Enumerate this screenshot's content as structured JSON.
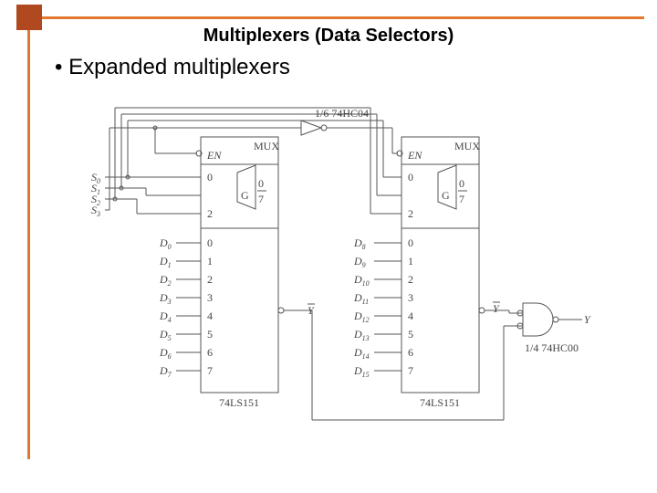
{
  "header": {
    "title": "Multiplexers (Data Selectors)"
  },
  "bullet": "•  Expanded multiplexers",
  "labels": {
    "inverter_chip": "1/6 74HC04",
    "nand_chip": "1/4 74HC00",
    "mux_caption_left": "74LS151",
    "mux_caption_right": "74LS151",
    "mux_title": "MUX",
    "en": "EN",
    "g": "G",
    "gfrac_top": "0",
    "gfrac_bot": "7",
    "ybar": "Y",
    "y": "Y",
    "sel": {
      "s0": "S",
      "s1": "S",
      "s2": "S",
      "s3": "S"
    },
    "sel_sub": {
      "s0": "0",
      "s1": "1",
      "s2": "2",
      "s3": "3"
    },
    "data_left": [
      "D",
      "D",
      "D",
      "D",
      "D",
      "D",
      "D",
      "D"
    ],
    "data_left_sub": [
      "0",
      "1",
      "2",
      "3",
      "4",
      "5",
      "6",
      "7"
    ],
    "data_right": [
      "D",
      "D",
      "D",
      "D",
      "D",
      "D",
      "D",
      "D"
    ],
    "data_right_sub": [
      "8",
      "9",
      "10",
      "11",
      "12",
      "13",
      "14",
      "15"
    ],
    "pin_left_top": [
      "0",
      "2"
    ],
    "pin_data": [
      "0",
      "1",
      "2",
      "3",
      "4",
      "5",
      "6",
      "7"
    ]
  }
}
